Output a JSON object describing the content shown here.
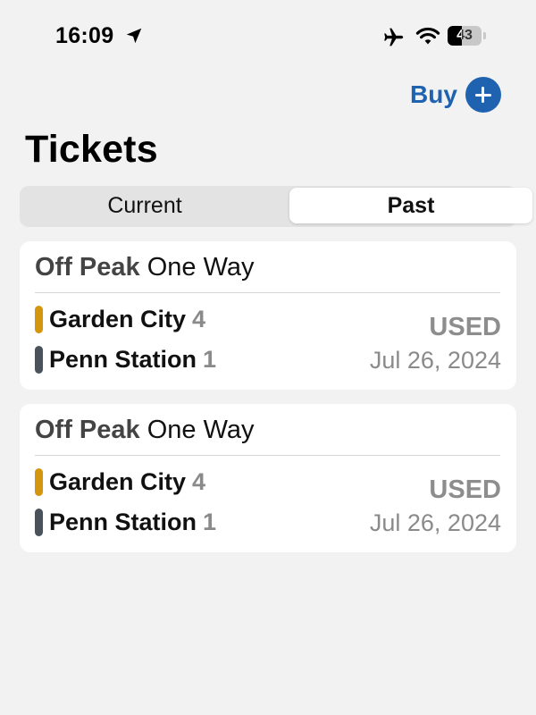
{
  "status_bar": {
    "time": "16:09",
    "battery_level": "43",
    "battery_fraction": 0.43,
    "icons": [
      "location-arrow-icon",
      "airplane-icon",
      "wifi-icon",
      "battery-icon"
    ]
  },
  "header": {
    "buy_label": "Buy",
    "buy_icon": "plus-circle-icon",
    "title": "Tickets"
  },
  "tabs": [
    {
      "label": "Current",
      "selected": false
    },
    {
      "label": "Past",
      "selected": true
    }
  ],
  "colors": {
    "accent": "#1e62b0",
    "origin_branch": "#d4950f",
    "destination_branch": "#4a525c"
  },
  "tickets": [
    {
      "type": "Off Peak",
      "trip": "One Way",
      "origin": {
        "name": "Garden City",
        "zone": "4"
      },
      "destination": {
        "name": "Penn Station",
        "zone": "1"
      },
      "status": "USED",
      "date": "Jul 26, 2024"
    },
    {
      "type": "Off Peak",
      "trip": "One Way",
      "origin": {
        "name": "Garden City",
        "zone": "4"
      },
      "destination": {
        "name": "Penn Station",
        "zone": "1"
      },
      "status": "USED",
      "date": "Jul 26, 2024"
    }
  ]
}
